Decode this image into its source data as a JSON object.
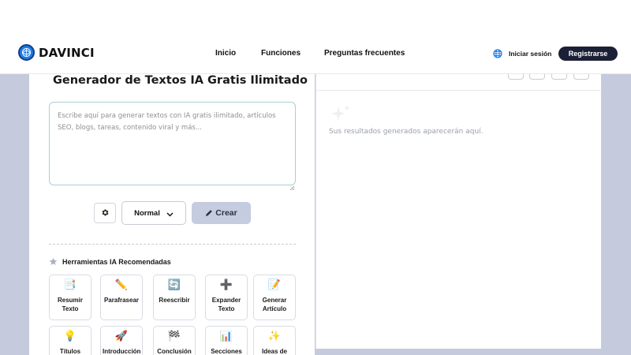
{
  "brand": {
    "name": "DAVINCI",
    "accent": "#1f7ae8"
  },
  "nav": {
    "links": [
      "Inicio",
      "Funciones",
      "Preguntas frecuentes"
    ],
    "login_label": "Iniciar sesión",
    "register_label": "Registrarse",
    "language_icon": "globe-icon"
  },
  "generator": {
    "title": "Generador de Textos IA Gratis Ilimitado",
    "prompt_placeholder": "Escribe aquí para generar textos con IA gratis ilimitado, artículos SEO, blogs, tareas, contenido viral y más...",
    "settings_icon": "gear-icon",
    "mode_value": "Normal",
    "create_label": "Crear",
    "tools_heading": "Herramientas IA Recomendadas",
    "tools": [
      {
        "icon": "📑",
        "label": "Resumir Texto"
      },
      {
        "icon": "✏️",
        "label": "Parafrasear"
      },
      {
        "icon": "🔄",
        "label": "Reescribir"
      },
      {
        "icon": "➕",
        "label": "Expander Texto"
      },
      {
        "icon": "📝",
        "label": "Generar Artículo"
      },
      {
        "icon": "💡",
        "label": "Títulos"
      },
      {
        "icon": "🚀",
        "label": "Introducción"
      },
      {
        "icon": "🏁",
        "label": "Conclusión"
      },
      {
        "icon": "📊",
        "label": "Secciones"
      },
      {
        "icon": "✨",
        "label": "Ideas de"
      }
    ]
  },
  "results": {
    "placeholder": "Sus resultados generados aparecerán aquí."
  },
  "colors": {
    "page_bg": "#c5cbdd",
    "register_bg": "#1c2036",
    "create_bg": "#c6cce0",
    "prompt_border": "#a9cfd4"
  }
}
